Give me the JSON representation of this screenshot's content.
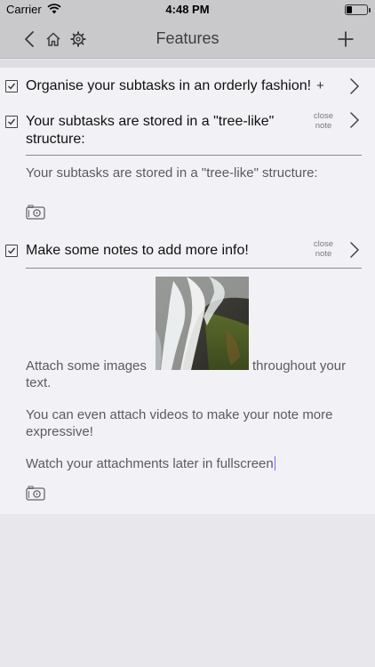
{
  "status_bar": {
    "carrier": "Carrier",
    "time": "4:48 PM"
  },
  "nav": {
    "title": "Features"
  },
  "rows": [
    {
      "title": "Organise your subtasks in an orderly fashion!",
      "action": "+"
    },
    {
      "title": "Your subtasks are stored in a \"tree-like\" structure:",
      "action": "close note",
      "note": "Your subtasks are stored in a \"tree-like\" structure:"
    },
    {
      "title": "Make some notes to add more info!",
      "action": "close note",
      "note_lines": {
        "attach_before": "Attach some images",
        "attach_after": "throughout your",
        "attach_end": "text.",
        "videos": "You can even attach videos to make your note more expressive!",
        "fullscreen": "Watch your attachments later in fullscreen"
      }
    }
  ],
  "icons": [
    "back-chevron-icon",
    "home-icon",
    "gear-icon",
    "plus-icon",
    "wifi-icon",
    "battery-icon",
    "checkbox-checked-icon",
    "chevron-right-icon",
    "camera-icon"
  ]
}
